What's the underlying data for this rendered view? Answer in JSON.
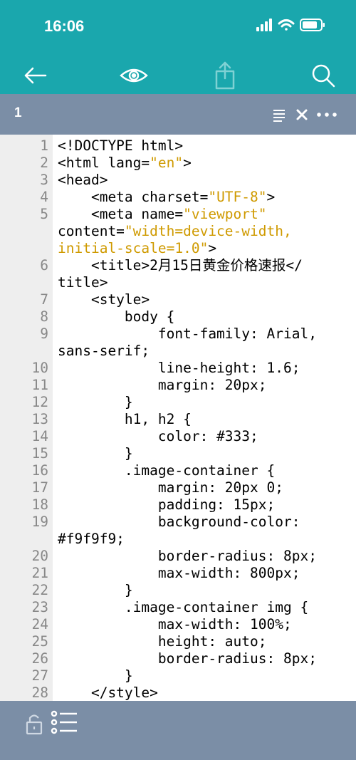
{
  "status_bar": {
    "time": "16:06"
  },
  "toolbar": {
    "back": "back-arrow-icon",
    "preview": "eye-icon",
    "share": "share-icon",
    "search": "search-icon",
    "accent": "#1aa7ad"
  },
  "tab": {
    "title": "1"
  },
  "editor": {
    "lines": [
      {
        "n": "1",
        "t": "<!DOCTYPE html>"
      },
      {
        "n": "2",
        "t": "<html lang=\"en\">"
      },
      {
        "n": "3",
        "t": "<head>"
      },
      {
        "n": "4",
        "t": "    <meta charset=\"UTF-8\">"
      },
      {
        "n": "5",
        "t": "    <meta name=\"viewport\""
      },
      {
        "n": "",
        "t": "content=\"width=device-width,"
      },
      {
        "n": "",
        "t": "initial-scale=1.0\">"
      },
      {
        "n": "6",
        "t": "    <title>2月15日黄金价格速报</"
      },
      {
        "n": "",
        "t": "title>"
      },
      {
        "n": "7",
        "t": "    <style>"
      },
      {
        "n": "8",
        "t": "        body {"
      },
      {
        "n": "9",
        "t": "            font-family: Arial,"
      },
      {
        "n": "",
        "t": "sans-serif;"
      },
      {
        "n": "10",
        "t": "            line-height: 1.6;"
      },
      {
        "n": "11",
        "t": "            margin: 20px;"
      },
      {
        "n": "12",
        "t": "        }"
      },
      {
        "n": "13",
        "t": "        h1, h2 {"
      },
      {
        "n": "14",
        "t": "            color: #333;"
      },
      {
        "n": "15",
        "t": "        }"
      },
      {
        "n": "16",
        "t": "        .image-container {"
      },
      {
        "n": "17",
        "t": "            margin: 20px 0;"
      },
      {
        "n": "18",
        "t": "            padding: 15px;"
      },
      {
        "n": "19",
        "t": "            background-color:"
      },
      {
        "n": "",
        "t": "#f9f9f9;"
      },
      {
        "n": "20",
        "t": "            border-radius: 8px;"
      },
      {
        "n": "21",
        "t": "            max-width: 800px;"
      },
      {
        "n": "22",
        "t": "        }"
      },
      {
        "n": "23",
        "t": "        .image-container img {"
      },
      {
        "n": "24",
        "t": "            max-width: 100%;"
      },
      {
        "n": "25",
        "t": "            height: auto;"
      },
      {
        "n": "26",
        "t": "            border-radius: 8px;"
      },
      {
        "n": "27",
        "t": "        }"
      },
      {
        "n": "28",
        "t": "    </style>"
      }
    ]
  },
  "bottom_bar": {
    "lock": "lock-icon",
    "outline": "list-icon"
  }
}
